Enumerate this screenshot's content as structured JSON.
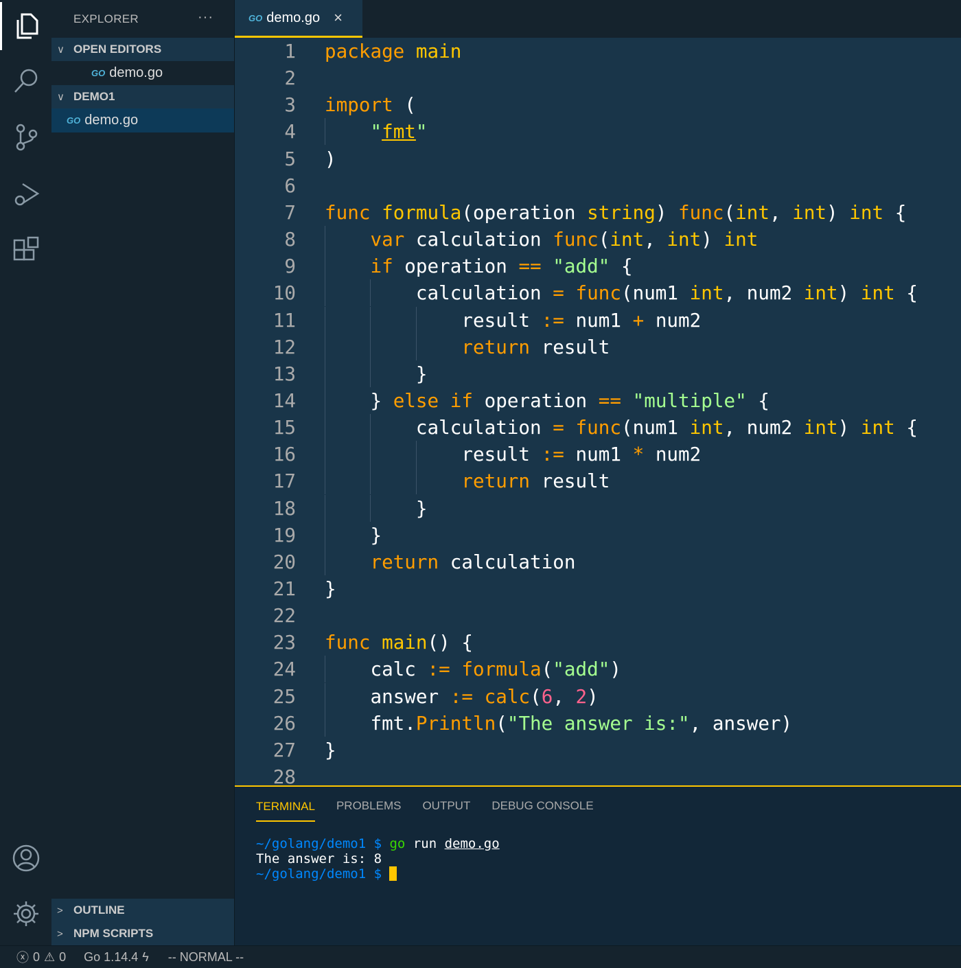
{
  "activity_bar": {
    "items": [
      "files-icon",
      "search-icon",
      "source-control-icon",
      "run-debug-icon",
      "extensions-icon"
    ],
    "bottom": [
      "account-icon",
      "gear-icon"
    ]
  },
  "sidebar": {
    "title": "EXPLORER",
    "more": "···",
    "open_editors": {
      "label": "OPEN EDITORS",
      "files": [
        "demo.go"
      ]
    },
    "folder": {
      "label": "DEMO1",
      "files": [
        "demo.go"
      ]
    },
    "outline": "OUTLINE",
    "npm_scripts": "NPM SCRIPTS",
    "go_icon": "GO"
  },
  "tab": {
    "label": "demo.go",
    "close": "×"
  },
  "colors": {
    "keyword": "#ff9d00",
    "function": "#ffc600",
    "string": "#a5ff90",
    "number": "#ff628c",
    "background": "#193549",
    "sidebar": "#15232d",
    "accent": "#ffc600"
  },
  "code": [
    [
      [
        "kw",
        "package"
      ],
      [
        "pl",
        " "
      ],
      [
        "fn",
        "main"
      ]
    ],
    [],
    [
      [
        "kw",
        "import"
      ],
      [
        "pl",
        " ("
      ]
    ],
    [
      [
        "pl",
        "    "
      ],
      [
        "str",
        "\""
      ],
      [
        "ul",
        "fmt"
      ],
      [
        "str",
        "\""
      ]
    ],
    [
      [
        "pl",
        ")"
      ]
    ],
    [],
    [
      [
        "kw",
        "func"
      ],
      [
        "pl",
        " "
      ],
      [
        "fn",
        "formula"
      ],
      [
        "pl",
        "(operation "
      ],
      [
        "ty",
        "string"
      ],
      [
        "pl",
        ") "
      ],
      [
        "kw",
        "func"
      ],
      [
        "pl",
        "("
      ],
      [
        "ty",
        "int"
      ],
      [
        "pl",
        ", "
      ],
      [
        "ty",
        "int"
      ],
      [
        "pl",
        ") "
      ],
      [
        "ty",
        "int"
      ],
      [
        "pl",
        " {"
      ]
    ],
    [
      [
        "pl",
        "    "
      ],
      [
        "kw",
        "var"
      ],
      [
        "pl",
        " calculation "
      ],
      [
        "kw",
        "func"
      ],
      [
        "pl",
        "("
      ],
      [
        "ty",
        "int"
      ],
      [
        "pl",
        ", "
      ],
      [
        "ty",
        "int"
      ],
      [
        "pl",
        ") "
      ],
      [
        "ty",
        "int"
      ]
    ],
    [
      [
        "pl",
        "    "
      ],
      [
        "kw",
        "if"
      ],
      [
        "pl",
        " operation "
      ],
      [
        "op",
        "=="
      ],
      [
        "pl",
        " "
      ],
      [
        "str",
        "\"add\""
      ],
      [
        "pl",
        " {"
      ]
    ],
    [
      [
        "pl",
        "        calculation "
      ],
      [
        "op",
        "="
      ],
      [
        "pl",
        " "
      ],
      [
        "kw",
        "func"
      ],
      [
        "pl",
        "(num1 "
      ],
      [
        "ty",
        "int"
      ],
      [
        "pl",
        ", num2 "
      ],
      [
        "ty",
        "int"
      ],
      [
        "pl",
        ") "
      ],
      [
        "ty",
        "int"
      ],
      [
        "pl",
        " {"
      ]
    ],
    [
      [
        "pl",
        "            result "
      ],
      [
        "op",
        ":="
      ],
      [
        "pl",
        " num1 "
      ],
      [
        "op",
        "+"
      ],
      [
        "pl",
        " num2"
      ]
    ],
    [
      [
        "pl",
        "            "
      ],
      [
        "kw",
        "return"
      ],
      [
        "pl",
        " result"
      ]
    ],
    [
      [
        "pl",
        "        }"
      ]
    ],
    [
      [
        "pl",
        "    } "
      ],
      [
        "kw",
        "else"
      ],
      [
        "pl",
        " "
      ],
      [
        "kw",
        "if"
      ],
      [
        "pl",
        " operation "
      ],
      [
        "op",
        "=="
      ],
      [
        "pl",
        " "
      ],
      [
        "str",
        "\"multiple\""
      ],
      [
        "pl",
        " {"
      ]
    ],
    [
      [
        "pl",
        "        calculation "
      ],
      [
        "op",
        "="
      ],
      [
        "pl",
        " "
      ],
      [
        "kw",
        "func"
      ],
      [
        "pl",
        "(num1 "
      ],
      [
        "ty",
        "int"
      ],
      [
        "pl",
        ", num2 "
      ],
      [
        "ty",
        "int"
      ],
      [
        "pl",
        ") "
      ],
      [
        "ty",
        "int"
      ],
      [
        "pl",
        " {"
      ]
    ],
    [
      [
        "pl",
        "            result "
      ],
      [
        "op",
        ":="
      ],
      [
        "pl",
        " num1 "
      ],
      [
        "op",
        "*"
      ],
      [
        "pl",
        " num2"
      ]
    ],
    [
      [
        "pl",
        "            "
      ],
      [
        "kw",
        "return"
      ],
      [
        "pl",
        " result"
      ]
    ],
    [
      [
        "pl",
        "        }"
      ]
    ],
    [
      [
        "pl",
        "    }"
      ]
    ],
    [
      [
        "pl",
        "    "
      ],
      [
        "kw",
        "return"
      ],
      [
        "pl",
        " calculation"
      ]
    ],
    [
      [
        "pl",
        "}"
      ]
    ],
    [],
    [
      [
        "kw",
        "func"
      ],
      [
        "pl",
        " "
      ],
      [
        "fn",
        "main"
      ],
      [
        "pl",
        "() {"
      ]
    ],
    [
      [
        "pl",
        "    calc "
      ],
      [
        "op",
        ":="
      ],
      [
        "pl",
        " "
      ],
      [
        "call",
        "formula"
      ],
      [
        "pl",
        "("
      ],
      [
        "str",
        "\"add\""
      ],
      [
        "pl",
        ")"
      ]
    ],
    [
      [
        "pl",
        "    answer "
      ],
      [
        "op",
        ":="
      ],
      [
        "pl",
        " "
      ],
      [
        "call",
        "calc"
      ],
      [
        "pl",
        "("
      ],
      [
        "num",
        "6"
      ],
      [
        "pl",
        ", "
      ],
      [
        "num",
        "2"
      ],
      [
        "pl",
        ")"
      ]
    ],
    [
      [
        "pl",
        "    fmt."
      ],
      [
        "call",
        "Println"
      ],
      [
        "pl",
        "("
      ],
      [
        "str",
        "\"The answer is:\""
      ],
      [
        "pl",
        ", answer)"
      ]
    ],
    [
      [
        "pl",
        "}"
      ]
    ],
    []
  ],
  "panel": {
    "tabs": [
      "TERMINAL",
      "PROBLEMS",
      "OUTPUT",
      "DEBUG CONSOLE"
    ],
    "active": "TERMINAL",
    "terminal": {
      "prompt": "~/golang/demo1 $",
      "cmd_go": "go",
      "cmd_run": "run",
      "cmd_file": "demo.go",
      "output": "The answer is: 8"
    }
  },
  "status": {
    "errors": "0",
    "warnings": "0",
    "go_version": "Go 1.14.4",
    "mode": "-- NORMAL --"
  }
}
